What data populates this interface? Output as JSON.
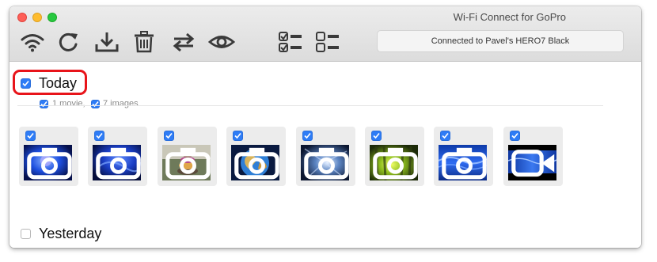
{
  "window": {
    "title": "Wi-Fi Connect for GoPro"
  },
  "toolbar": {
    "icons": [
      "wifi-icon",
      "refresh-icon",
      "download-icon",
      "trash-icon",
      "sync-icon",
      "eye-icon",
      "select-all-icon",
      "deselect-all-icon"
    ],
    "status": "Connected to Pavel's HERO7 Black"
  },
  "sections": [
    {
      "title": "Today",
      "checked": true,
      "movies_label": "1 movie,",
      "images_label": "7 images",
      "items": [
        {
          "type": "photo",
          "scene": "blue-glow"
        },
        {
          "type": "photo",
          "scene": "blue-glow-dark"
        },
        {
          "type": "photo",
          "scene": "stones"
        },
        {
          "type": "photo",
          "scene": "earth"
        },
        {
          "type": "photo",
          "scene": "blue-burst"
        },
        {
          "type": "photo",
          "scene": "green-forest"
        },
        {
          "type": "photo",
          "scene": "blue-waves"
        },
        {
          "type": "video",
          "scene": "blue-letterbox"
        }
      ]
    },
    {
      "title": "Yesterday",
      "checked": false
    }
  ],
  "colors": {
    "accent": "#2e7cf6",
    "highlight": "#e8141a"
  }
}
